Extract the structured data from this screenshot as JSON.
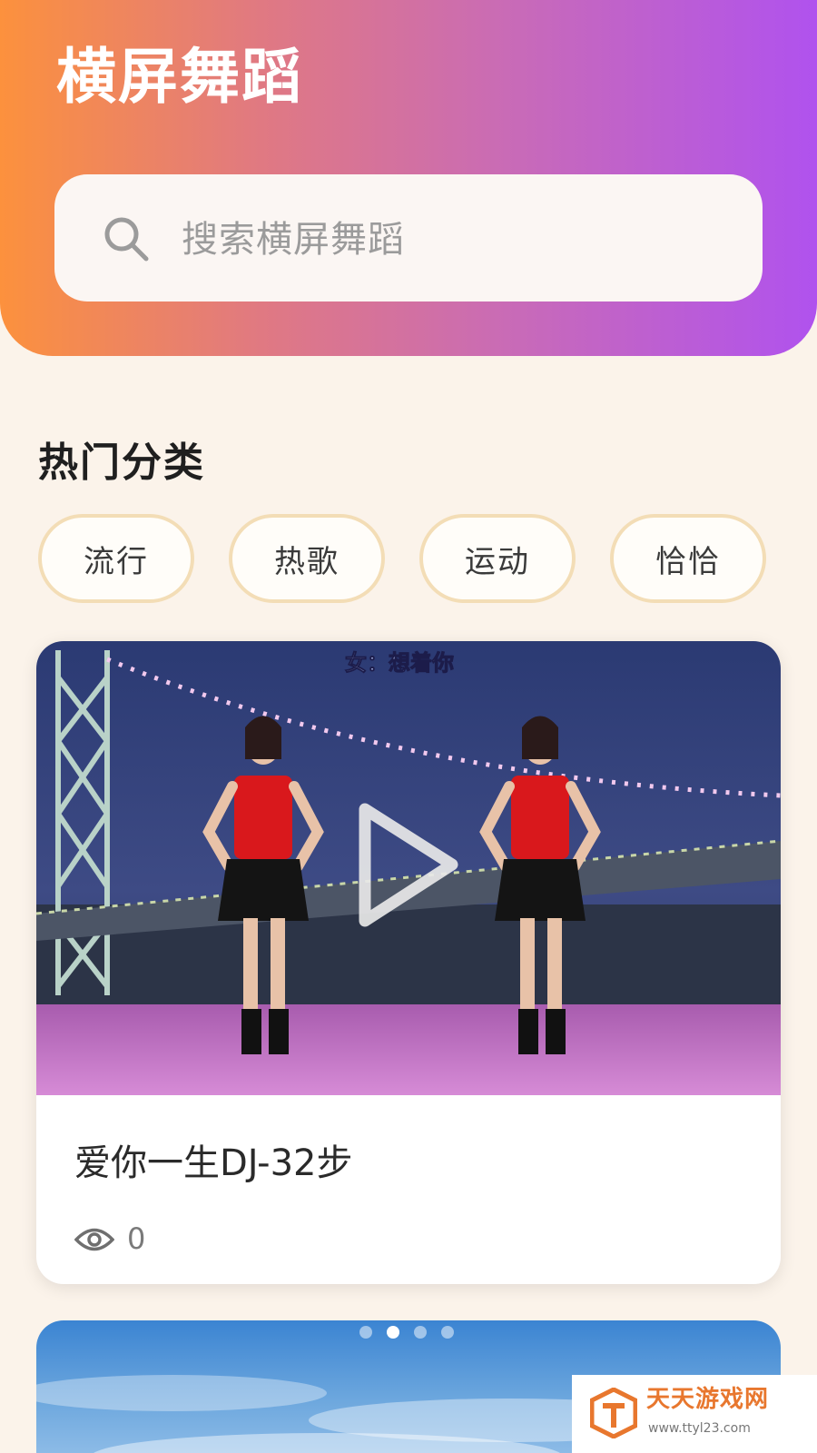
{
  "header": {
    "title": "横屏舞蹈",
    "search_placeholder": "搜索横屏舞蹈"
  },
  "section": {
    "title": "热门分类"
  },
  "categories": [
    "流行",
    "热歌",
    "运动",
    "恰恰"
  ],
  "video_card": {
    "subtitle_overlay": "女：想着你",
    "title": "爱你一生DJ-32步",
    "views": "0"
  },
  "carousel": {
    "dot_count": 4,
    "active_index": 1
  },
  "watermark": {
    "title": "天天游戏网",
    "url": "www.ttyl23.com"
  },
  "colors": {
    "gradient_start": "#fc913d",
    "gradient_end": "#b052ee",
    "chip_border": "#f3ddb6",
    "background": "#fbf3ea"
  }
}
